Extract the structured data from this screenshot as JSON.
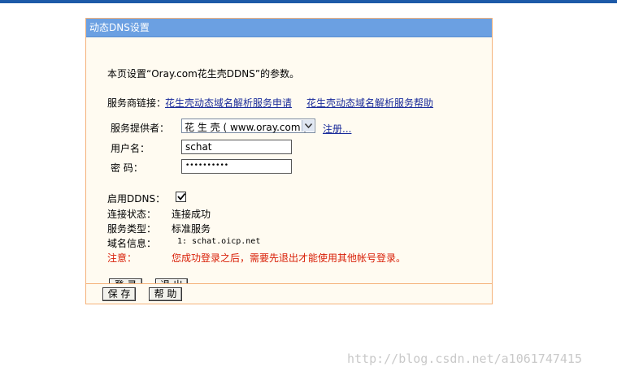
{
  "panel": {
    "title": "动态DNS设置",
    "intro": "本页设置“Oray.com花生壳DDNS”的参数。",
    "links_label": "服务商链接：",
    "link1": "花生壳动态域名解析服务申请",
    "link2": "花生壳动态域名解析服务帮助",
    "provider_label": "服务提供者：",
    "provider_value": "花 生 壳 ( www.oray.com )",
    "register_link": "注册...",
    "username_label": "用户名：",
    "username_value": "schat",
    "password_label": "密  码：",
    "password_value": "••••••••••",
    "enable_label": "启用DDNS：",
    "enable_checked": true,
    "status_label": "连接状态：",
    "status_value": "连接成功",
    "service_type_label": "服务类型：",
    "service_type_value": "标准服务",
    "domain_info_label": "域名信息：",
    "domain_info_value": "1: schat.oicp.net",
    "notice_label": "注意：",
    "notice_value": "您成功登录之后，需要先退出才能使用其他帐号登录。",
    "login_button": "登 录",
    "logout_button": "退 出",
    "save_button": "保 存",
    "help_button": "帮 助"
  },
  "watermark": "http://blog.csdn.net/a1061747415",
  "colors": {
    "header_bg": "#6ba0e2",
    "panel_border": "#f5b27a",
    "link": "#1a2b9a",
    "notice": "#d81e06"
  }
}
